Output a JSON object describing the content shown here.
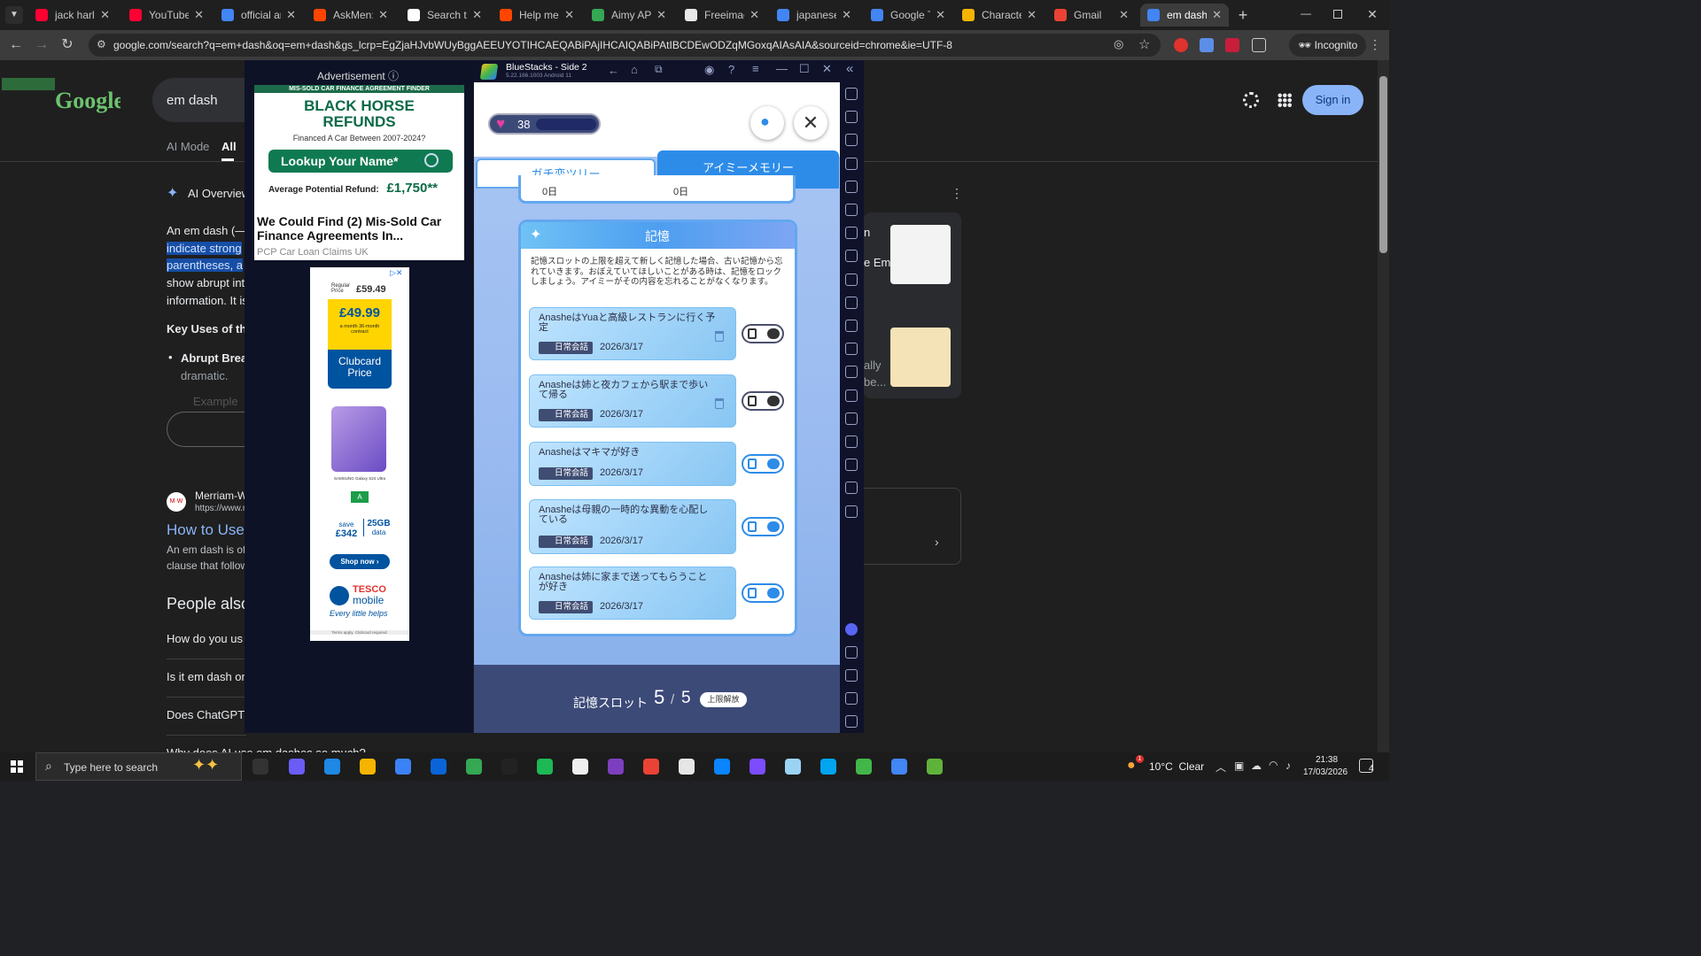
{
  "browser": {
    "tabs": [
      {
        "title": "jack harlow",
        "color": "#ff0033"
      },
      {
        "title": "YouTube",
        "color": "#ff0033"
      },
      {
        "title": "official art",
        "color": "#4285f4"
      },
      {
        "title": "AskMen: a",
        "color": "#ff4500"
      },
      {
        "title": "Search thr",
        "color": "#ffffff"
      },
      {
        "title": "Help me u",
        "color": "#ff4500"
      },
      {
        "title": "Aimy APK",
        "color": "#34a853"
      },
      {
        "title": "Freeimage",
        "color": "#e8e8e8"
      },
      {
        "title": "japanese t",
        "color": "#4285f4"
      },
      {
        "title": "Google Tra",
        "color": "#4285f4"
      },
      {
        "title": "Character",
        "color": "#f4b400"
      },
      {
        "title": "Gmail",
        "color": "#ea4335"
      },
      {
        "title": "em dash -",
        "color": "#4285f4"
      }
    ],
    "new_tab": "+",
    "url": "google.com/search?q=em+dash&oq=em+dash&gs_lcrp=EgZjaHJvbWUyBggAEEUYOTIHCAEQABiPAjIHCAIQABiPAtIBCDEwODZqMGoxqAIAsAIA&sourceid=chrome&ie=UTF-8",
    "incognito_label": "Incognito"
  },
  "google": {
    "search_value": "em dash",
    "tabs": [
      "AI Mode",
      "All"
    ],
    "sign_in": "Sign in",
    "ai_overview": "AI Overview",
    "ai_text": [
      "An em dash (—",
      "indicate strong",
      "parentheses, a",
      "show abrupt int",
      "information. It is"
    ],
    "key_uses": "Key Uses of th",
    "bullet": "Abrupt Brea",
    "bullet_sub": "dramatic.",
    "example": "Example",
    "source_name": "Merriam-W",
    "source_url": "https://www.m",
    "result_title": "How to Use",
    "snippet_1": "An em dash is of",
    "snippet_2": "clause that follow",
    "people_also": "People also",
    "questions": [
      "How do you us",
      "Is it em dash or",
      "Does ChatGPT",
      "Why does AI use em dashes so much?"
    ],
    "right_panel_1": "n",
    "right_panel_2": "e Em",
    "right_panel_3": "ally",
    "right_panel_4": "be..."
  },
  "ad_panel": {
    "label": "Advertisement",
    "ad1": {
      "top_banner": "MIS-SOLD CAR FINANCE AGREEMENT FINDER",
      "brand": "BLACK HORSE",
      "brand2": "REFUNDS",
      "sub": "Financed A Car Between 2007-2024?",
      "cta": "Lookup Your Name*",
      "refund_label": "Average Potential Refund:",
      "refund_value": "£1,750**",
      "headline": "We Could Find (2) Mis-Sold Car Finance Agreements In...",
      "advertiser": "PCP Car Loan Claims UK"
    },
    "ad2": {
      "regular_label": "Regular Price",
      "regular_price": "£59.49",
      "price": "£49.99",
      "price_sub": "a month 36-month contract",
      "clubcard": "Clubcard Price",
      "phone_caption": "SAMSUNG Galaxy S24 Ultra",
      "energy": "A",
      "save_label": "save",
      "save_value": "£342",
      "data_value": "25GB",
      "data_label": "data",
      "shop": "Shop now",
      "tesco": "TESCO",
      "mobile": "mobile",
      "tagline": "Every little helps",
      "terms": "Terms apply. Clubcard required."
    }
  },
  "bluestacks": {
    "title": "BlueStacks - Side 2",
    "version": "5.22.166.1003  Android 11"
  },
  "game": {
    "hearts": "38",
    "tab_left": "ガチ恋ツリー",
    "tab_right": "アイミーメモリー",
    "prev_row_left": "0日",
    "prev_row_right": "0日",
    "section_title": "記憶",
    "description": "記憶スロットの上限を超えて新しく記憶した場合、古い記憶から忘れていきます。おぼえていてほしいことがある時は、記憶をロックしましょう。アイミーがその内容を忘れることがなくなります。",
    "memories": [
      {
        "text": "AnasheはYuaと高級レストランに行く予定",
        "tag": "日常会話",
        "date": "2026/3/17",
        "locked": false
      },
      {
        "text": "Anasheは姉と夜カフェから駅まで歩いて帰る",
        "tag": "日常会話",
        "date": "2026/3/17",
        "locked": false
      },
      {
        "text": "Anasheはマキマが好き",
        "tag": "日常会話",
        "date": "2026/3/17",
        "locked": true
      },
      {
        "text": "Anasheは母親の一時的な異動を心配している",
        "tag": "日常会話",
        "date": "2026/3/17",
        "locked": true
      },
      {
        "text": "Anasheは姉に家まで送ってもらうことが好き",
        "tag": "日常会話",
        "date": "2026/3/17",
        "locked": true
      }
    ],
    "slot_label": "記憶スロット",
    "slot_used": "5",
    "slot_sep": "/",
    "slot_max": "5",
    "unlock_label": "上限解放"
  },
  "taskbar": {
    "search_placeholder": "Type here to search",
    "weather": "10°C  Clear",
    "weather_badge": "1",
    "time": "21:38",
    "date": "17/03/2026",
    "notif_count": "4"
  }
}
